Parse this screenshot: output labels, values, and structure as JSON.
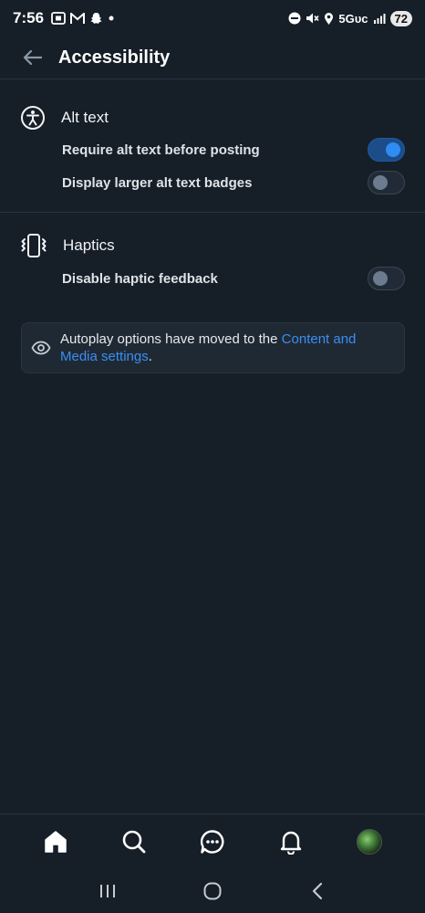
{
  "status_bar": {
    "time": "7:56",
    "network": "5Gᴜᴄ",
    "battery": "72",
    "left_icons": [
      "screenshot-icon",
      "gmail-icon",
      "snapchat-icon",
      "dot-icon"
    ],
    "right_icons": [
      "dnd-icon",
      "mute-icon",
      "location-icon",
      "signal-icon"
    ]
  },
  "header": {
    "back_icon": "back-arrow-icon",
    "title": "Accessibility"
  },
  "sections": {
    "alt_text": {
      "icon": "accessibility-icon",
      "title": "Alt text",
      "rows": [
        {
          "label": "Require alt text before posting",
          "on": true
        },
        {
          "label": "Display larger alt text badges",
          "on": false
        }
      ]
    },
    "haptics": {
      "icon": "phone-vibrate-icon",
      "title": "Haptics",
      "rows": [
        {
          "label": "Disable haptic feedback",
          "on": false
        }
      ]
    }
  },
  "notice": {
    "icon": "eye-icon",
    "text": "Autoplay options have moved to the ",
    "link": "Content and Media settings",
    "suffix": "."
  },
  "tabbar": {
    "items": [
      "home-icon",
      "search-icon",
      "messages-icon",
      "notifications-icon",
      "avatar"
    ]
  },
  "navbar": {
    "items": [
      "recents-icon",
      "home-circle-icon",
      "back-chevron-icon"
    ]
  },
  "colors": {
    "background": "#161e27",
    "accent": "#2f8cf3",
    "link": "#3b8ef2"
  }
}
